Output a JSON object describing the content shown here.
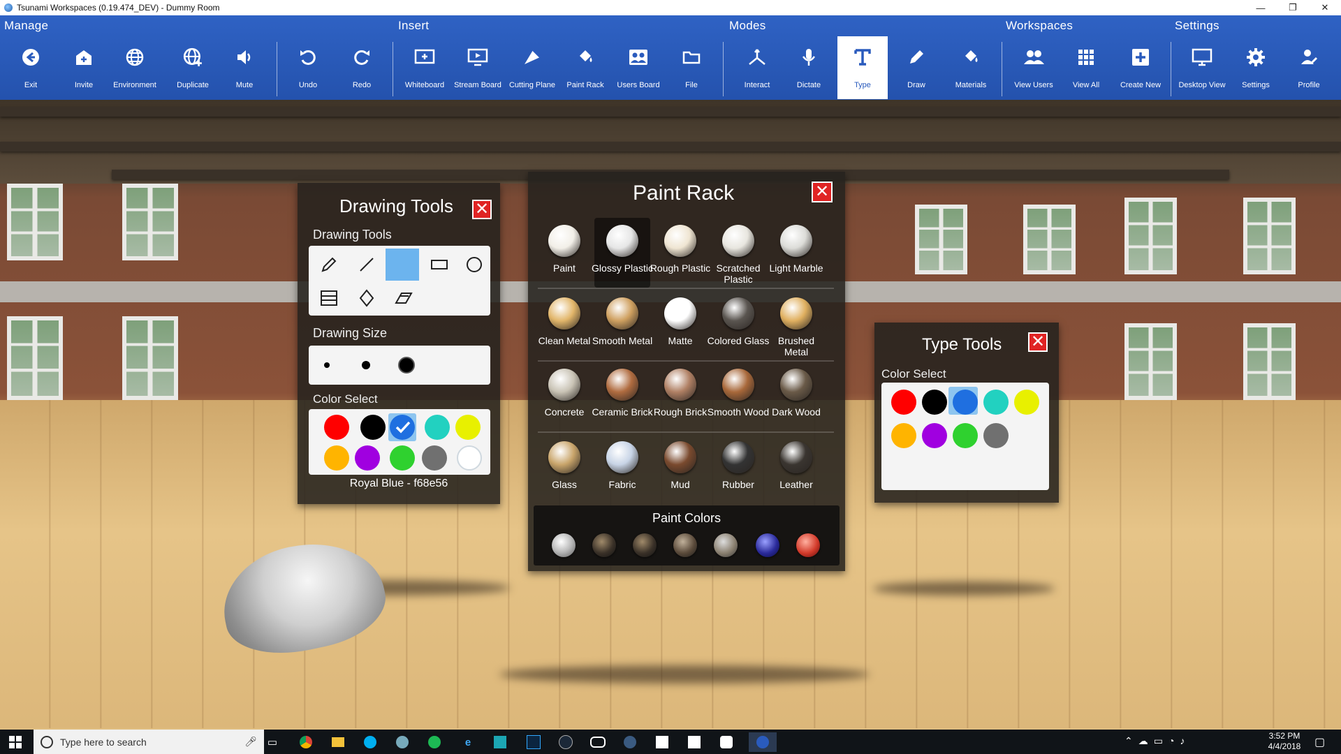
{
  "window": {
    "title": "Tsunami Workspaces (0.19.474_DEV) - Dummy Room",
    "minimize": "—",
    "maximize": "❐",
    "close": "✕"
  },
  "ribbon": {
    "groups": {
      "manage": "Manage",
      "insert": "Insert",
      "modes": "Modes",
      "workspaces": "Workspaces",
      "settings": "Settings"
    },
    "buttons": {
      "exit": "Exit",
      "invite": "Invite",
      "environment": "Environment",
      "duplicate": "Duplicate",
      "mute": "Mute",
      "undo": "Undo",
      "redo": "Redo",
      "whiteboard": "Whiteboard",
      "stream_board": "Stream Board",
      "cutting_plane": "Cutting Plane",
      "paint_rack": "Paint Rack",
      "users_board": "Users Board",
      "file": "File",
      "interact": "Interact",
      "dictate": "Dictate",
      "type": "Type",
      "draw": "Draw",
      "materials": "Materials",
      "view_users": "View Users",
      "view_all": "View All",
      "create_new": "Create New",
      "desktop_view": "Desktop View",
      "settings": "Settings",
      "profile": "Profile"
    }
  },
  "drawing_tools": {
    "title": "Drawing Tools",
    "tools_label": "Drawing Tools",
    "size_label": "Drawing Size",
    "color_label": "Color Select",
    "selected_color": "Royal Blue - f68e56",
    "colors": [
      "#ff0000",
      "#000000",
      "#1f6fe0",
      "#22d1c0",
      "#e8f000",
      "#ffb400",
      "#a000e0",
      "#2fd12f",
      "#707070",
      "#ffffff"
    ]
  },
  "paint_rack": {
    "title": "Paint Rack",
    "materials": [
      [
        "Paint",
        "Glossy Plastic",
        "Rough Plastic",
        "Scratched Plastic",
        "Light Marble"
      ],
      [
        "Clean Metal",
        "Smooth Metal",
        "Matte",
        "Colored Glass",
        "Brushed Metal"
      ],
      [
        "Concrete",
        "Ceramic Brick",
        "Rough Brick",
        "Smooth Wood",
        "Dark Wood"
      ],
      [
        "Glass",
        "Fabric",
        "Mud",
        "Rubber",
        "Leather"
      ]
    ],
    "paint_colors_label": "Paint Colors"
  },
  "type_tools": {
    "title": "Type Tools",
    "color_label": "Color Select",
    "colors": [
      "#ff0000",
      "#000000",
      "#1f6fe0",
      "#22d1c0",
      "#e8f000",
      "#ffb400",
      "#a000e0",
      "#2fd12f",
      "#707070"
    ]
  },
  "taskbar": {
    "search_placeholder": "Type here to search",
    "time": "3:52 PM",
    "date": "4/4/2018"
  }
}
